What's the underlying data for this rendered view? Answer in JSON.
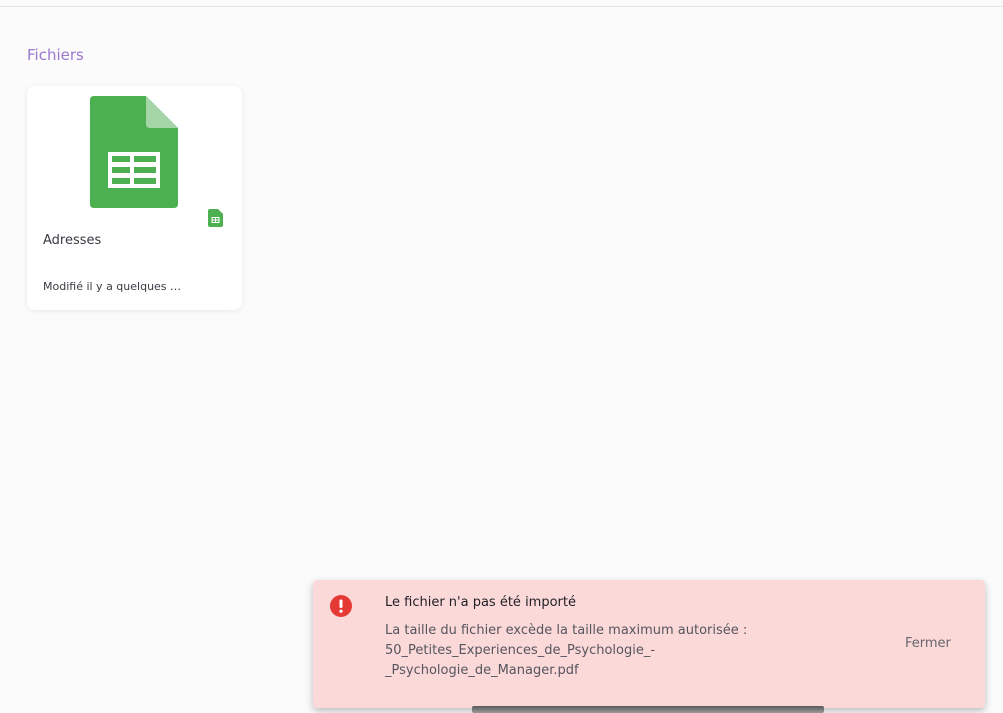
{
  "section": {
    "title": "Fichiers"
  },
  "files": [
    {
      "name": "Adresses",
      "modified": "Modifié il y a quelques …",
      "type_icon": "spreadsheet-icon"
    }
  ],
  "toast": {
    "title": "Le fichier n'a pas été importé",
    "message_lines": [
      "La taille du fichier excède la taille maximum autorisée :",
      "50_Petites_Experiences_de_Psychologie_-",
      "_Psychologie_de_Manager.pdf"
    ],
    "close_label": "Fermer",
    "icon": "error-icon"
  },
  "colors": {
    "accent": "#9a78d0",
    "sheets_green": "#4caf50",
    "error_red": "#e53935",
    "toast_bg": "#fcd9d9"
  }
}
